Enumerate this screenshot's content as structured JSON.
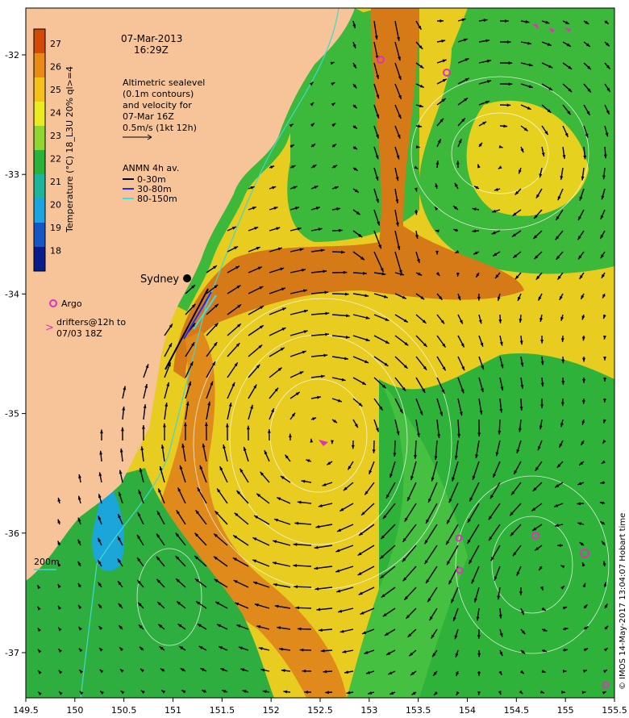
{
  "title": {
    "date": "07-Mar-2013",
    "time": "16:29Z"
  },
  "altimetry_note": [
    "Altimetric sealevel",
    "(0.1m contours)",
    "and velocity for",
    "07-Mar 16Z",
    "0.5m/s (1kt 12h)"
  ],
  "anmn": {
    "title": "ANMN 4h av.",
    "items": [
      {
        "label": "0-30m",
        "color": "#000000"
      },
      {
        "label": "30-80m",
        "color": "#1a2bff"
      },
      {
        "label": "80-150m",
        "color": "#38e0f0"
      }
    ]
  },
  "colorbar": {
    "label": "Temperature (°C) 18_L3U 20% ql>=4",
    "ticks": [
      "27",
      "26",
      "25",
      "24",
      "23",
      "22",
      "21",
      "20",
      "19",
      "18"
    ],
    "stops": [
      "#d24a05",
      "#e98a14",
      "#f3c11a",
      "#eceb20",
      "#8fd630",
      "#2bb23a",
      "#1db49a",
      "#1ba4e0",
      "#1457c4",
      "#0a1c8a"
    ]
  },
  "legend": {
    "argo": "Argo",
    "drifters_line1": "drifters@12h to",
    "drifters_line2": "07/03 18Z"
  },
  "place": "Sydney",
  "scale_label": "200m",
  "credit": "© IMOS 14-May-2017 13:04:07 Hobart time",
  "axes": {
    "x_ticks": [
      "149.5",
      "150",
      "150.5",
      "151",
      "151.5",
      "152",
      "152.5",
      "153",
      "153.5",
      "154",
      "154.5",
      "155",
      "155.5"
    ],
    "y_ticks": [
      "-32",
      "-33",
      "-34",
      "-35",
      "-36",
      "-37"
    ]
  },
  "colors": {
    "land": "#f7c49a",
    "warm": "#c86414",
    "orange": "#e89a22",
    "yellow": "#e8d21e",
    "green": "#3cb83a",
    "cool": "#18a080",
    "argo": "#e030c0"
  }
}
